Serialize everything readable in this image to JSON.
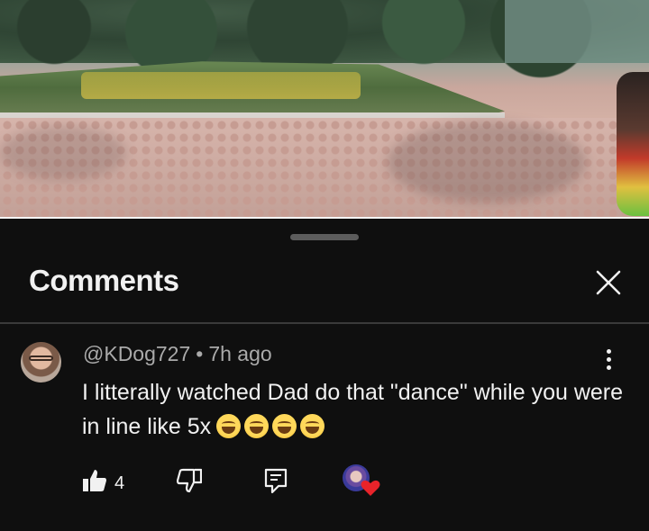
{
  "sheet": {
    "title": "Comments"
  },
  "comment": {
    "author": "@KDog727",
    "separator": "•",
    "time_ago": "7h ago",
    "text": "I litterally watched Dad do that \"dance\" while you were in line like 5x",
    "emoji": [
      "grinning-squinting-face",
      "grinning-squinting-face",
      "grinning-squinting-face",
      "grinning-squinting-face"
    ],
    "like_count": "4"
  },
  "colors": {
    "background": "#0f0f0f",
    "text_primary": "#f1f1f1",
    "text_secondary": "#aaaaaa",
    "divider": "#3a3a3a",
    "heart": "#e8232a"
  },
  "icons": {
    "close": "close-icon",
    "more": "more-vert-icon",
    "like": "thumb-up-filled-icon",
    "dislike": "thumb-down-icon",
    "reply": "reply-comment-icon",
    "creator_heart": "creator-heart-icon"
  }
}
